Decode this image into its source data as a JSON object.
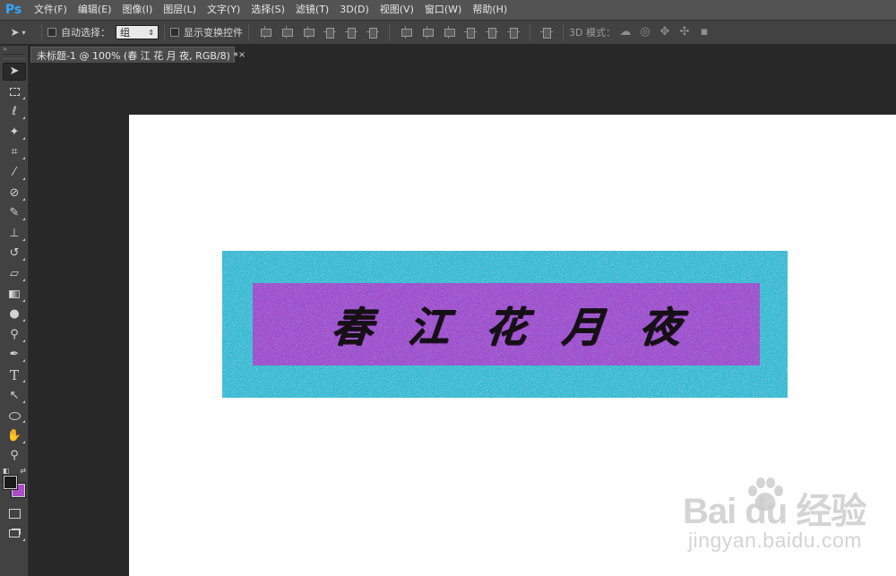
{
  "app": {
    "logo": "Ps"
  },
  "menu": {
    "items": [
      "文件(F)",
      "编辑(E)",
      "图像(I)",
      "图层(L)",
      "文字(Y)",
      "选择(S)",
      "滤镜(T)",
      "3D(D)",
      "视图(V)",
      "窗口(W)",
      "帮助(H)"
    ]
  },
  "options": {
    "auto_select_label": "自动选择：",
    "auto_select_value": "组",
    "show_transform_label": "显示变换控件",
    "mode3d_label": "3D 模式："
  },
  "document": {
    "tab_title": "未标题-1 @ 100% (春 江 花 月 夜, RGB/8) *",
    "close_glyph": "×"
  },
  "artwork": {
    "chars": [
      "春",
      "江",
      "花",
      "月",
      "夜"
    ],
    "colors": {
      "outer": "#2fb8d3",
      "inner": "#9c46c6",
      "text": "#141014"
    }
  },
  "swatches": {
    "foreground": "#1a1a1a",
    "background": "#a84fc6"
  },
  "watermark": {
    "brand": "Bai du 经验",
    "url": "jingyan.baidu.com"
  }
}
